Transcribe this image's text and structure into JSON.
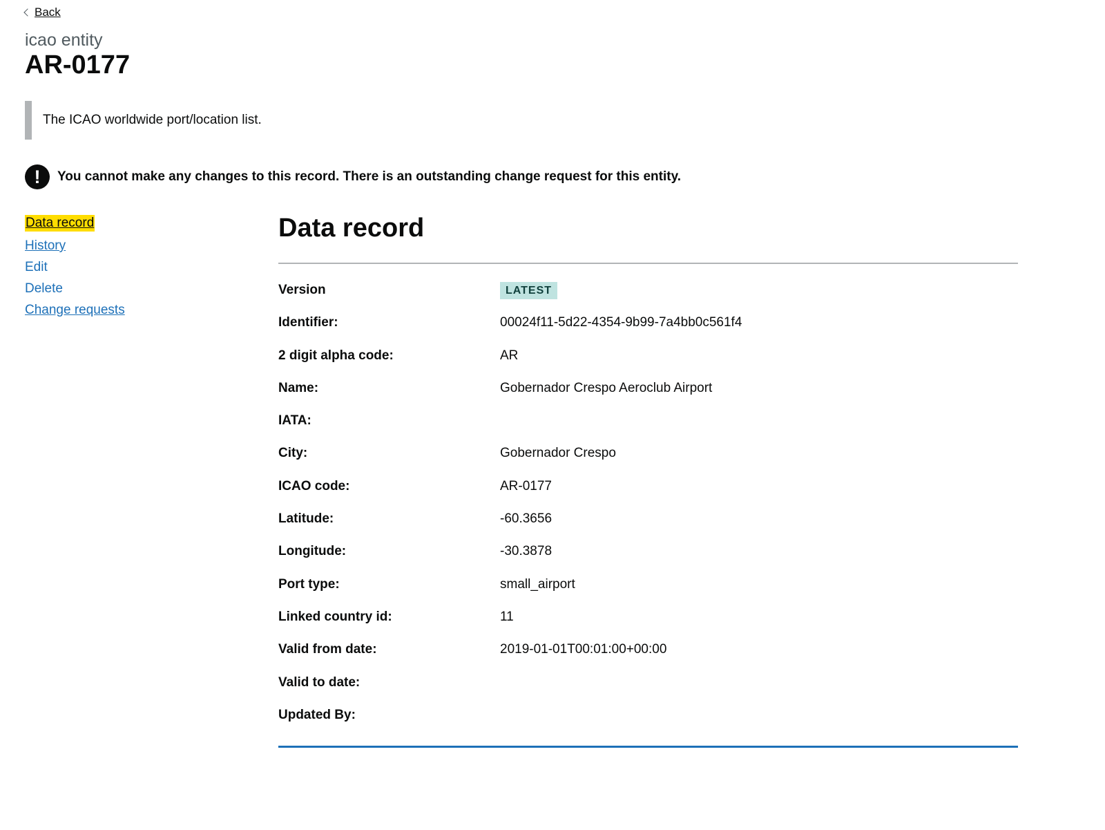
{
  "nav": {
    "back_label": "Back"
  },
  "header": {
    "caption": "icao entity",
    "title": "AR-0177"
  },
  "inset_text": "The ICAO worldwide port/location list.",
  "warning": {
    "icon_glyph": "!",
    "text": "You cannot make any changes to this record. There is an outstanding change request for this entity."
  },
  "sidenav": {
    "items": [
      {
        "label": "Data record"
      },
      {
        "label": "History"
      },
      {
        "label": "Edit"
      },
      {
        "label": "Delete"
      },
      {
        "label": "Change requests"
      }
    ]
  },
  "record": {
    "heading": "Data record",
    "version_label": "Version",
    "version_tag": "LATEST",
    "rows": [
      {
        "key": "Identifier:",
        "value": "00024f11-5d22-4354-9b99-7a4bb0c561f4"
      },
      {
        "key": "2 digit alpha code:",
        "value": "AR"
      },
      {
        "key": "Name:",
        "value": "Gobernador Crespo Aeroclub Airport"
      },
      {
        "key": "IATA:",
        "value": ""
      },
      {
        "key": "City:",
        "value": "Gobernador Crespo"
      },
      {
        "key": "ICAO code:",
        "value": "AR-0177"
      },
      {
        "key": "Latitude:",
        "value": "-60.3656"
      },
      {
        "key": "Longitude:",
        "value": "-30.3878"
      },
      {
        "key": "Port type:",
        "value": "small_airport"
      },
      {
        "key": "Linked country id:",
        "value": "11"
      },
      {
        "key": "Valid from date:",
        "value": "2019-01-01T00:01:00+00:00"
      },
      {
        "key": "Valid to date:",
        "value": ""
      },
      {
        "key": "Updated By:",
        "value": ""
      }
    ]
  },
  "colors": {
    "link": "#1d70b8",
    "focus": "#ffdd00",
    "tag_bg": "#bfe3e0",
    "tag_text": "#10403c",
    "rule": "#b1b4b6"
  }
}
